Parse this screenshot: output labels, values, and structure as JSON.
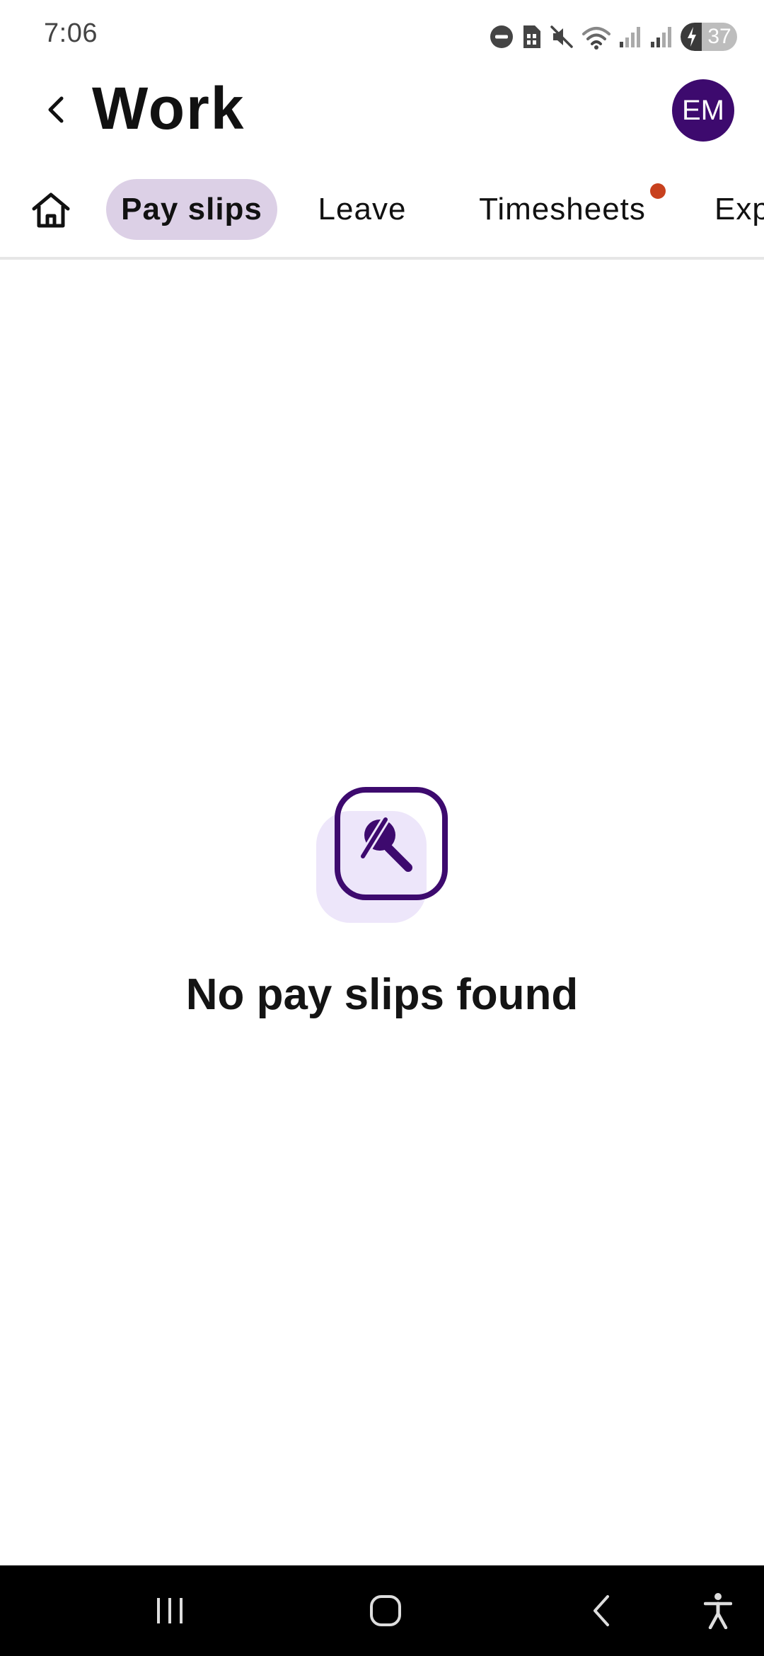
{
  "status_bar": {
    "time": "7:06",
    "battery_level": "37",
    "icons": [
      "dnd-icon",
      "sim-icon",
      "mute-icon",
      "wifi-icon",
      "signal-icon",
      "signal-icon",
      "battery-charging-icon"
    ]
  },
  "header": {
    "title": "Work",
    "avatar_initials": "EM",
    "avatar_color": "#3d0a6e"
  },
  "tabs": {
    "items": [
      {
        "label": "Pay slips",
        "active": true
      },
      {
        "label": "Leave",
        "active": false
      },
      {
        "label": "Timesheets",
        "active": false,
        "notification": true
      },
      {
        "label": "Exp",
        "active": false
      }
    ],
    "active_color": "#dcd0e6",
    "notification_color": "#c8411e"
  },
  "empty_state": {
    "message": "No pay slips found",
    "icon": "search-off-icon",
    "accent_color": "#3d0a6e"
  },
  "nav_bar": {
    "buttons": [
      "recents-icon",
      "home-icon",
      "back-icon",
      "accessibility-icon"
    ]
  }
}
